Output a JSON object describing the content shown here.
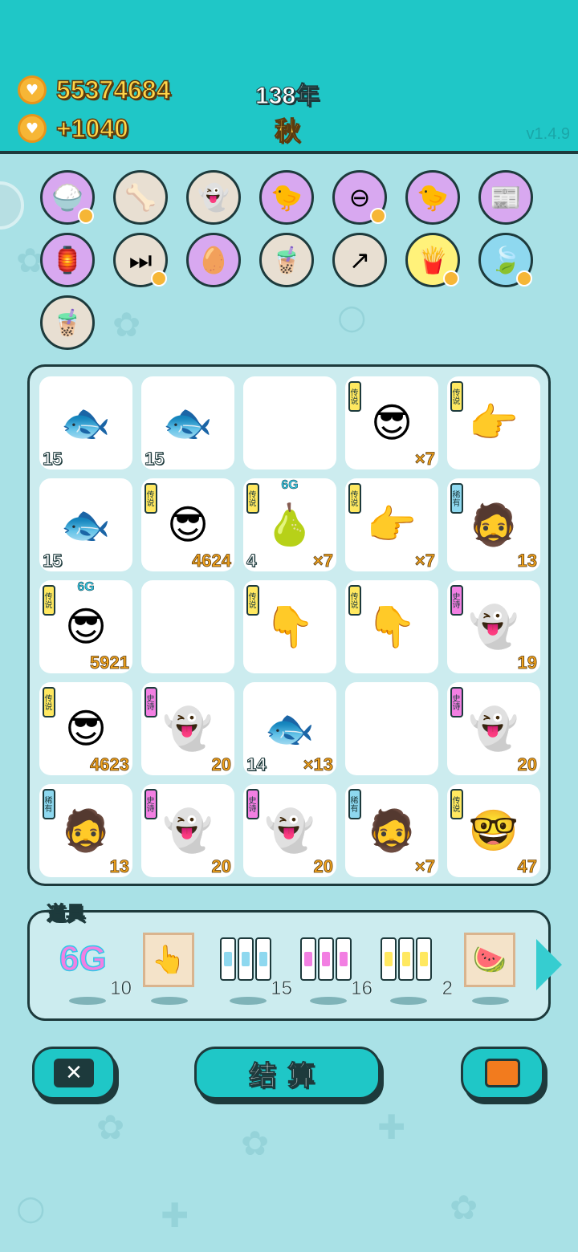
{
  "header": {
    "coins": "55374684",
    "income": "+1040",
    "year": "138年",
    "season": "秋",
    "version": "v1.4.9"
  },
  "icons_row1": [
    {
      "icon": "rice-bowl-icon",
      "glyph": "🍚",
      "bg": "#d8a8f0",
      "heart": true
    },
    {
      "icon": "dog-bowl-icon",
      "glyph": "🦴",
      "bg": "#e8dfd2",
      "heart": false
    },
    {
      "icon": "ghost-wink-icon",
      "glyph": "👻",
      "bg": "#e8dfd2",
      "heart": false
    },
    {
      "icon": "chick-egg-icon",
      "glyph": "🐤",
      "bg": "#d8a8f0",
      "heart": false
    },
    {
      "icon": "minus-circle-icon",
      "glyph": "⊖",
      "bg": "#d8a8f0",
      "heart": true
    },
    {
      "icon": "chick-egg-icon",
      "glyph": "🐤",
      "bg": "#d8a8f0",
      "heart": false
    },
    {
      "icon": "time-magazine-icon",
      "glyph": "📰",
      "bg": "#d8a8f0",
      "heart": false
    }
  ],
  "icons_row2": [
    {
      "icon": "ghost-lantern-icon",
      "glyph": "🏮",
      "bg": "#d8a8f0",
      "heart": false
    },
    {
      "icon": "skip-icon",
      "glyph": "⏭",
      "bg": "#e8dfd2",
      "heart": true
    },
    {
      "icon": "egg-icon",
      "glyph": "🥚",
      "bg": "#d8a8f0",
      "heart": false
    },
    {
      "icon": "bubble-tea-icon",
      "glyph": "🧋",
      "bg": "#e8dfd2",
      "heart": false
    },
    {
      "icon": "arrow-card-icon",
      "glyph": "↗",
      "bg": "#e8dfd2",
      "heart": false
    },
    {
      "icon": "fries-icon",
      "glyph": "🍟",
      "bg": "#fff27a",
      "heart": true
    },
    {
      "icon": "leaf-icon",
      "glyph": "🍃",
      "bg": "#8ed8ef",
      "heart": true
    }
  ],
  "icons_row3": [
    {
      "icon": "bubble-tea-icon",
      "glyph": "🧋",
      "bg": "#e8dfd2",
      "heart": false
    }
  ],
  "grid": [
    [
      {
        "fig": "🐟",
        "left": "15",
        "right": ""
      },
      {
        "fig": "🐟",
        "left": "15",
        "right": ""
      },
      {
        "fig": "",
        "left": "",
        "right": ""
      },
      {
        "fig": "😎",
        "tag": "传说",
        "tagClass": "leg",
        "left": "",
        "right": "×7"
      },
      {
        "fig": "👉",
        "tag": "传说",
        "tagClass": "leg",
        "left": "",
        "right": ""
      }
    ],
    [
      {
        "fig": "🐟",
        "left": "15",
        "right": ""
      },
      {
        "fig": "😎",
        "tag": "传说",
        "tagClass": "leg",
        "left": "",
        "right": "4624"
      },
      {
        "fig": "🍐",
        "tag": "传说",
        "tagClass": "leg",
        "g6": "6G",
        "left": "4",
        "right": "×7"
      },
      {
        "fig": "👉",
        "tag": "传说",
        "tagClass": "leg",
        "left": "",
        "right": "×7"
      },
      {
        "fig": "🧔",
        "tag": "稀有",
        "tagClass": "rar",
        "left": "",
        "right": "13"
      }
    ],
    [
      {
        "fig": "😎",
        "tag": "传说",
        "tagClass": "leg",
        "g6": "6G",
        "left": "",
        "right": "5921"
      },
      {
        "fig": "",
        "left": "",
        "right": ""
      },
      {
        "fig": "👇",
        "tag": "传说",
        "tagClass": "leg",
        "left": "",
        "right": ""
      },
      {
        "fig": "👇",
        "tag": "传说",
        "tagClass": "leg",
        "left": "",
        "right": ""
      },
      {
        "fig": "👻",
        "tag": "史诗",
        "tagClass": "epi",
        "left": "",
        "right": "19"
      }
    ],
    [
      {
        "fig": "😎",
        "tag": "传说",
        "tagClass": "leg",
        "left": "",
        "right": "4623"
      },
      {
        "fig": "👻",
        "tag": "史诗",
        "tagClass": "epi",
        "left": "",
        "right": "20"
      },
      {
        "fig": "🐟",
        "left": "14",
        "right": "×13"
      },
      {
        "fig": "",
        "left": "",
        "right": ""
      },
      {
        "fig": "👻",
        "tag": "史诗",
        "tagClass": "epi",
        "left": "",
        "right": "20"
      }
    ],
    [
      {
        "fig": "🧔",
        "tag": "稀有",
        "tagClass": "rar",
        "left": "",
        "right": "13"
      },
      {
        "fig": "👻",
        "tag": "史诗",
        "tagClass": "epi",
        "left": "",
        "right": "20"
      },
      {
        "fig": "👻",
        "tag": "史诗",
        "tagClass": "epi",
        "left": "",
        "right": "20"
      },
      {
        "fig": "🧔",
        "tag": "稀有",
        "tagClass": "rar",
        "left": "",
        "right": "×7"
      },
      {
        "fig": "🤓",
        "tag": "传说",
        "tagClass": "leg",
        "left": "",
        "right": "47"
      }
    ]
  ],
  "tools": {
    "title": "道具",
    "items": [
      {
        "name": "6g-tool",
        "label": "6G",
        "count": "10"
      },
      {
        "name": "hand-card-tool",
        "glyph": "👆",
        "count": ""
      },
      {
        "name": "rare-cards-tool",
        "tier": "rar",
        "count": "15"
      },
      {
        "name": "epic-cards-tool",
        "tier": "epi",
        "count": "16"
      },
      {
        "name": "legend-cards-tool",
        "tier": "leg",
        "count": "2"
      },
      {
        "name": "watermelon-tool",
        "glyph": "🍉",
        "count": ""
      }
    ]
  },
  "buttons": {
    "settle": "结算"
  }
}
